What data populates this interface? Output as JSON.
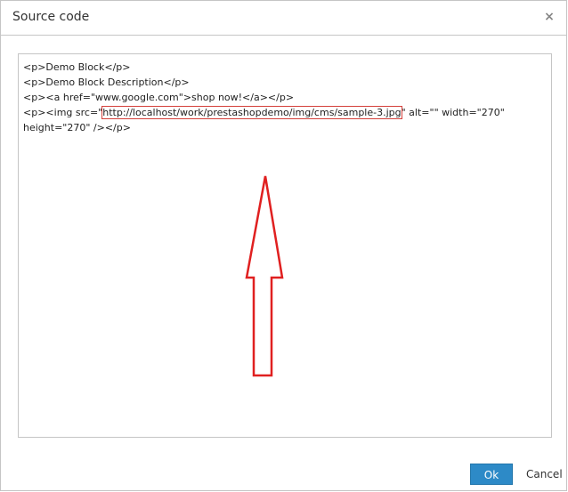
{
  "dialog": {
    "title": "Source code",
    "close_icon": "close-icon",
    "close_glyph": "×"
  },
  "editor": {
    "lines": [
      "<p>Demo Block</p>",
      "<p>Demo Block Description</p>",
      "<p><a href=\"www.google.com\">shop now!</a></p>"
    ],
    "img_line_prefix": "<p><img src=\"",
    "img_url": "http://localhost/work/prestashopdemo/img/cms/sample-3.jpg",
    "img_line_suffix": "\" alt=\"\" width=\"270\"",
    "img_line_cont": "height=\"270\" /></p>"
  },
  "annotation": {
    "arrow_color": "#e02020",
    "highlight_color": "#d43f3a"
  },
  "footer": {
    "ok_label": "Ok",
    "cancel_label": "Cancel"
  },
  "colors": {
    "accent": "#2d8ac7",
    "border": "#c5c5c5"
  }
}
